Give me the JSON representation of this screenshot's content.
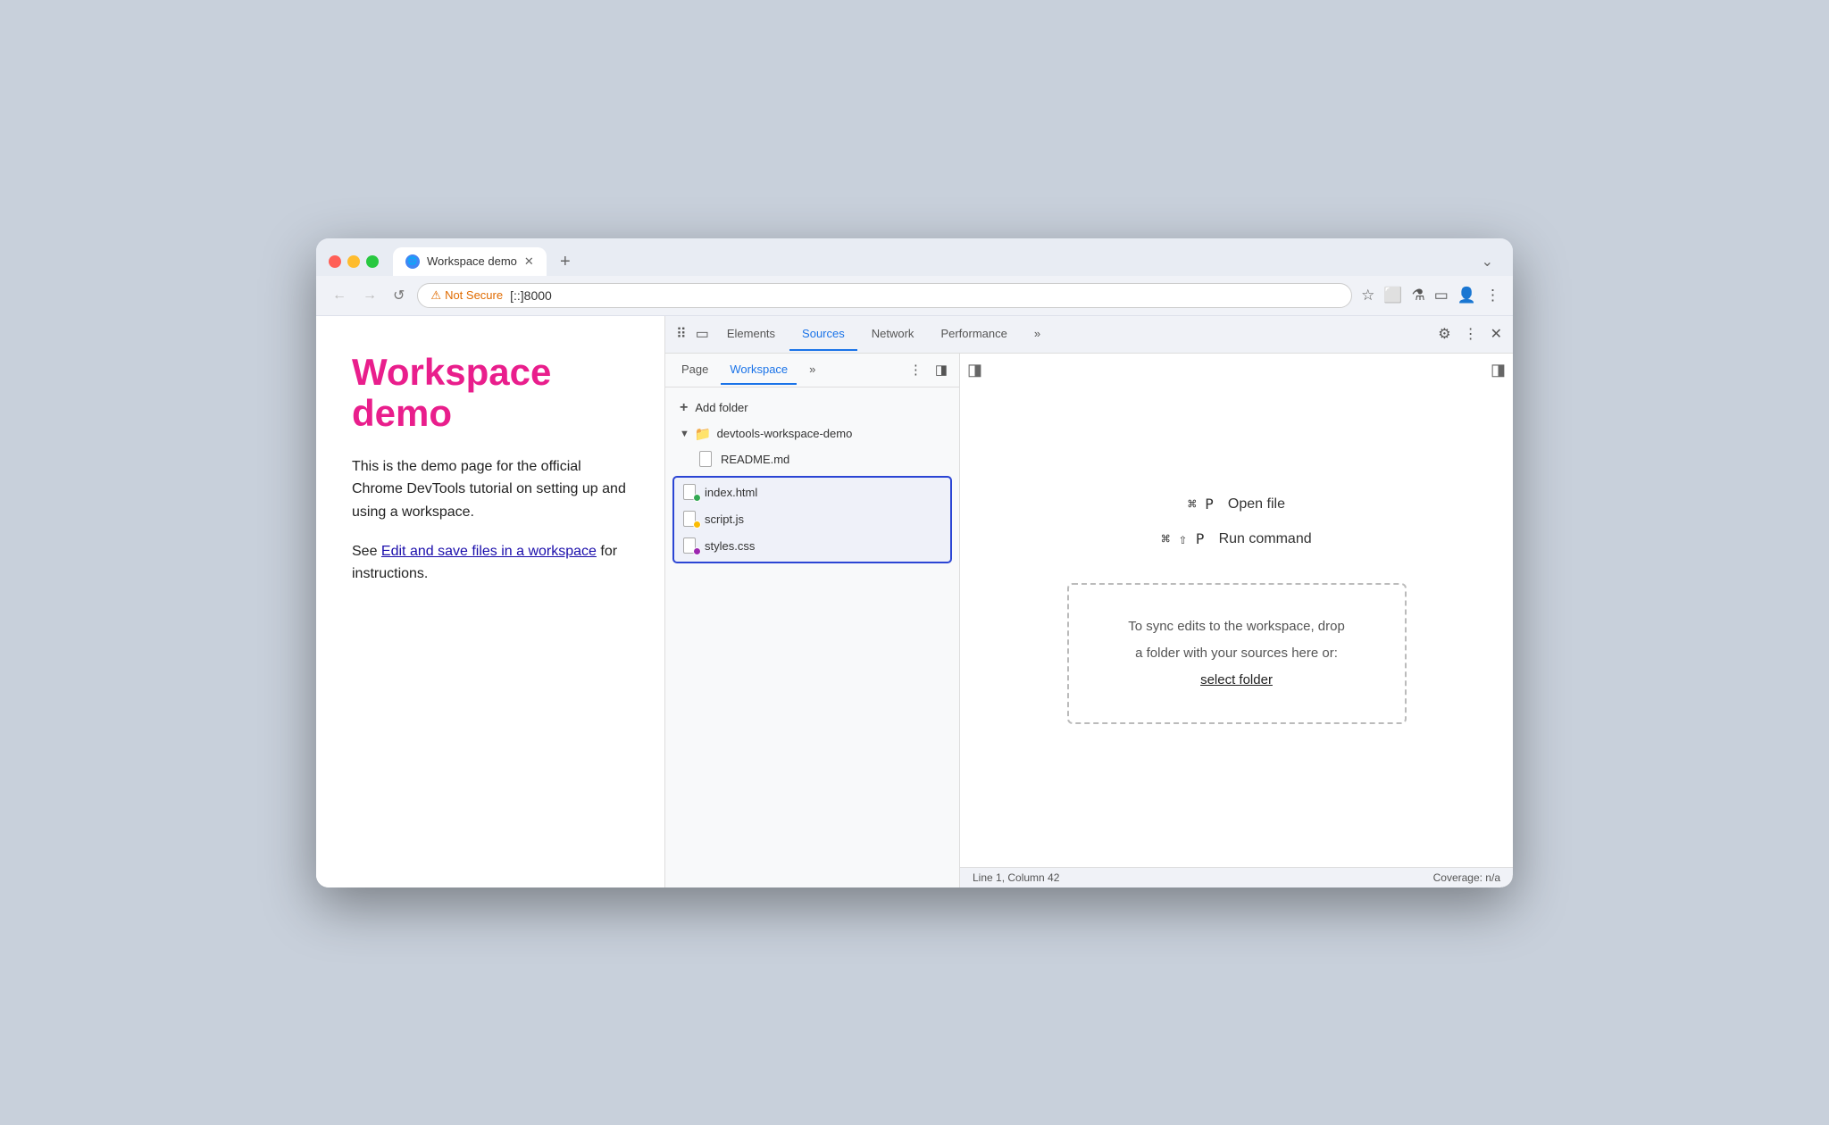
{
  "browser": {
    "traffic_lights": [
      "red",
      "yellow",
      "green"
    ],
    "tab": {
      "title": "Workspace demo",
      "favicon": "🌐",
      "close": "✕"
    },
    "new_tab": "+",
    "tab_more": "⌄",
    "nav": {
      "back": "←",
      "forward": "→",
      "reload": "↺",
      "not_secure_icon": "⚠",
      "not_secure": "Not Secure",
      "url": "[::]8000",
      "bookmark": "☆",
      "extension1": "⬜",
      "extension2": "⚗",
      "sidebar": "▭",
      "profile": "👤",
      "more": "⋮"
    }
  },
  "page": {
    "title": "Workspace demo",
    "text1": "This is the demo page for the official Chrome DevTools tutorial on setting up and using a workspace.",
    "text2_prefix": "See ",
    "text2_link": "Edit and save files in a workspace",
    "text2_suffix": " for instructions."
  },
  "devtools": {
    "tabs": [
      {
        "label": "Elements",
        "active": false
      },
      {
        "label": "Sources",
        "active": true
      },
      {
        "label": "Network",
        "active": false
      },
      {
        "label": "Performance",
        "active": false
      },
      {
        "label": "»",
        "active": false
      }
    ],
    "icons": {
      "inspect": "⠿",
      "device": "▭",
      "settings": "⚙",
      "more": "⋮",
      "close": "✕"
    },
    "sidebar_icons": {
      "toggle_left": "◫",
      "toggle_right": "◨"
    },
    "sources": {
      "sub_tabs": [
        {
          "label": "Page",
          "active": false
        },
        {
          "label": "Workspace",
          "active": true
        }
      ],
      "more_tabs": "»",
      "menu_icon": "⋮",
      "toggle_panel": "◨",
      "toggle_right": "◨",
      "add_folder": "Add folder",
      "folder": {
        "name": "devtools-workspace-demo",
        "icon": "📁",
        "arrow": "▼"
      },
      "files": [
        {
          "name": "README.md",
          "dot": null,
          "highlighted": false
        },
        {
          "name": "index.html",
          "dot": "green",
          "highlighted": true
        },
        {
          "name": "script.js",
          "dot": "orange",
          "highlighted": true
        },
        {
          "name": "styles.css",
          "dot": "purple",
          "highlighted": true
        }
      ]
    },
    "editor": {
      "shortcut1_key": "⌘ P",
      "shortcut1_label": "Open file",
      "shortcut2_key": "⌘ ⇧ P",
      "shortcut2_label": "Run command",
      "drop_zone_line1": "To sync edits to the workspace, drop",
      "drop_zone_line2": "a folder with your sources here or:",
      "select_folder": "select folder"
    },
    "status_bar": {
      "left": "Line 1, Column 42",
      "right": "Coverage: n/a"
    }
  }
}
